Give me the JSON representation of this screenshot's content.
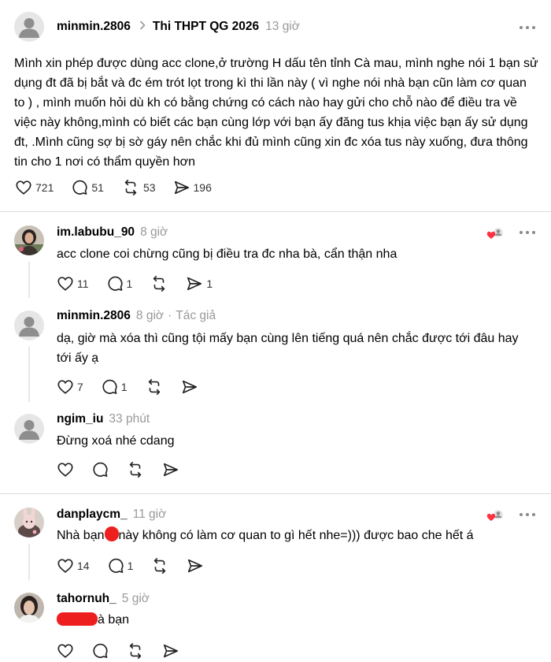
{
  "post": {
    "username": "minmin.2806",
    "topic": "Thi THPT QG 2026",
    "time": "13 giờ",
    "body": "Mình xin phép được dùng acc clone,ở trường H dấu tên tỉnh Cà mau, mình nghe nói 1 bạn sử dụng đt đã bị bắt và đc ém trót lọt trong kì thi lần này ( vì nghe nói nhà bạn cũn làm cơ quan to ) , mình muốn hỏi dù kh có bằng chứng có cách nào hay gửi cho chỗ nào để điều tra về việc này không,mình có biết các bạn cùng lớp với bạn ấy đăng tus khịa việc bạn ấy sử dụng đt, .Mình cũng sợ bị sờ gáy nên chắc khi đủ mình cũng xin đc xóa tus này xuống, đưa thông tin cho 1 nơi có thẩm quyền hơn",
    "likes": "721",
    "comments": "51",
    "reposts": "53",
    "shares": "196"
  },
  "replies": [
    {
      "username": "im.labubu_90",
      "time": "8 giờ",
      "body": "acc clone coi chừng cũng bị điều tra đc nha bà, cẩn thận nha",
      "likes": "11",
      "comments": "1",
      "shares": "1",
      "author_liked": true
    },
    {
      "username": "minmin.2806",
      "time": "8 giờ",
      "author_tag": "Tác giả",
      "body": "dạ, giờ mà xóa thì cũng tội mấy bạn cùng lên tiếng quá nên chắc được tới đâu hay tới ấy ạ",
      "likes": "7",
      "comments": "1"
    },
    {
      "username": "ngim_iu",
      "time": "33 phút",
      "body": "Đừng xoá nhé cdang"
    },
    {
      "username": "danplaycm_",
      "time": "11 giờ",
      "body_before": "Nhà bạn",
      "body_after": "này không có làm cơ quan to gì hết nhe=))) được bao che hết á",
      "likes": "14",
      "comments": "1",
      "author_liked": true
    },
    {
      "username": "tahornuh_",
      "time": "5 giờ",
      "body_after": "à bạn"
    }
  ],
  "colors": {
    "text": "#000000",
    "muted": "#999999",
    "divider": "#dcdcdc",
    "heart_red": "#ff3040",
    "redaction": "#ee1f1f"
  },
  "icons": [
    "more-icon",
    "chevron-right-icon",
    "heart-icon",
    "comment-icon",
    "repost-icon",
    "share-icon",
    "author-liked-icon"
  ]
}
